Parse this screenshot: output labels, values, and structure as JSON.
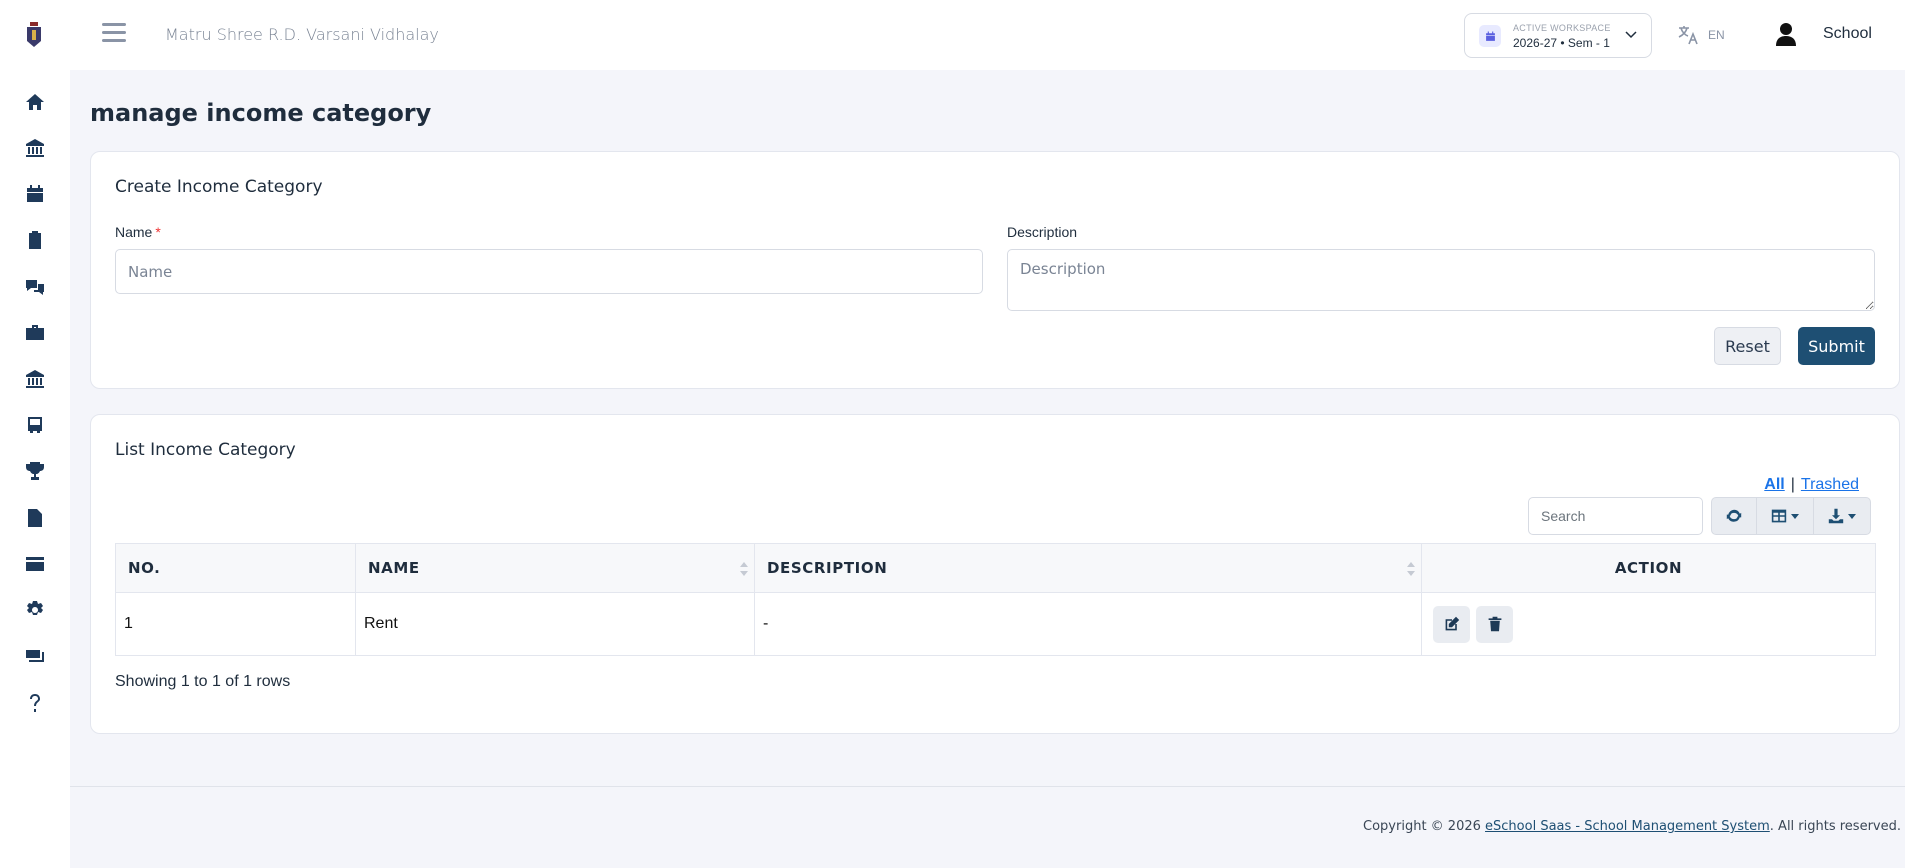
{
  "header": {
    "school_name": "Matru Shree R.D. Varsani Vidhalay",
    "workspace_label": "ACTIVE WORKSPACE",
    "workspace_value": "2026-27 • Sem - 1",
    "language": "EN",
    "user": "School"
  },
  "sidebar": {
    "items": [
      {
        "icon": "home-icon"
      },
      {
        "icon": "bank-icon"
      },
      {
        "icon": "calendar-icon"
      },
      {
        "icon": "clipboard-icon"
      },
      {
        "icon": "chat-icon"
      },
      {
        "icon": "briefcase-icon"
      },
      {
        "icon": "institution-icon"
      },
      {
        "icon": "bus-icon"
      },
      {
        "icon": "trophy-icon"
      },
      {
        "icon": "document-icon"
      },
      {
        "icon": "credit-card-icon"
      },
      {
        "icon": "gear-icon"
      },
      {
        "icon": "money-icon"
      },
      {
        "icon": "help-icon"
      }
    ]
  },
  "page": {
    "title": "manage income category"
  },
  "create_form": {
    "title": "Create Income Category",
    "name_label": "Name",
    "name_required": "*",
    "name_placeholder": "Name",
    "description_label": "Description",
    "description_placeholder": "Description",
    "reset_label": "Reset",
    "submit_label": "Submit"
  },
  "list": {
    "title": "List Income Category",
    "filter_all": "All",
    "filter_separator": "|",
    "filter_trashed": "Trashed",
    "search_placeholder": "Search",
    "columns": [
      "NO.",
      "NAME",
      "DESCRIPTION",
      "ACTION"
    ],
    "rows": [
      {
        "no": "1",
        "name": "Rent",
        "description": "-"
      }
    ],
    "pagination_info": "Showing 1 to 1 of 1 rows"
  },
  "footer": {
    "prefix": "Copyright © 2026 ",
    "link": "eSchool Saas - School Management System",
    "suffix": ". All rights reserved."
  },
  "colors": {
    "primary": "#1e4f73",
    "link": "#1a73e8",
    "background": "#f4f5fa"
  }
}
